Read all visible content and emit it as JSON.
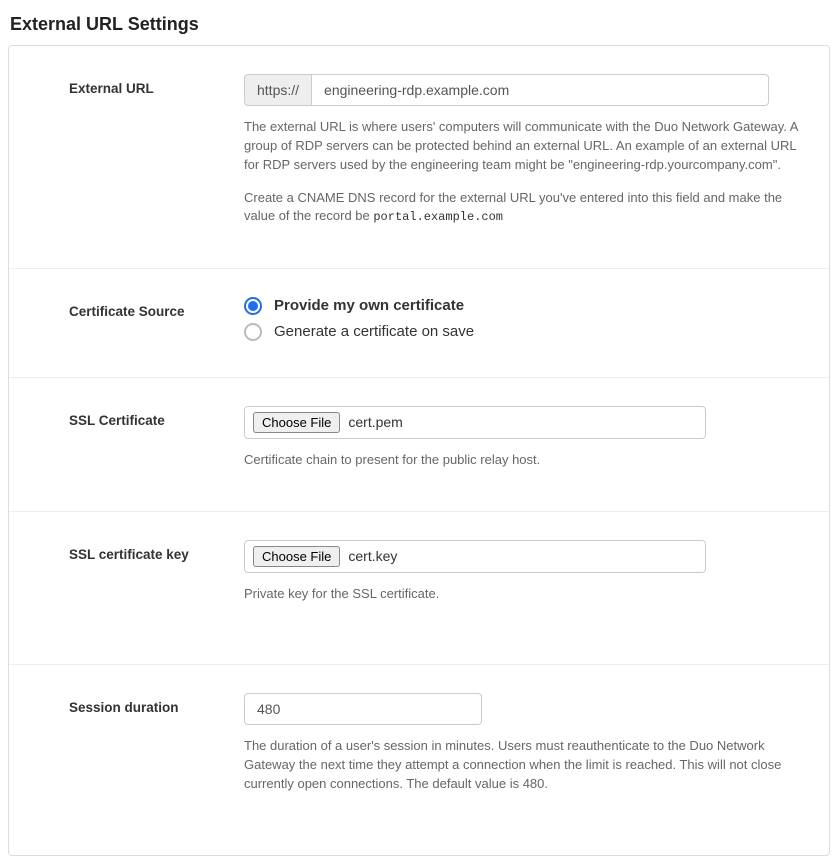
{
  "heading": "External URL Settings",
  "external_url": {
    "label": "External URL",
    "scheme": "https://",
    "value": "engineering-rdp.example.com",
    "help1": "The external URL is where users' computers will communicate with the Duo Network Gateway. A group of RDP servers can be protected behind an external URL. An example of an external URL for RDP servers used by the engineering team might be \"engineering-rdp.yourcompany.com\".",
    "help2_pre": "Create a CNAME DNS record for the external URL you've entered into this field and make the value of the record be ",
    "help2_code": "portal.example.com"
  },
  "cert_source": {
    "label": "Certificate Source",
    "options": [
      {
        "label": "Provide my own certificate",
        "selected": true
      },
      {
        "label": "Generate a certificate on save",
        "selected": false
      }
    ]
  },
  "ssl_cert": {
    "label": "SSL Certificate",
    "button": "Choose File",
    "file": "cert.pem",
    "help": "Certificate chain to present for the public relay host."
  },
  "ssl_key": {
    "label": "SSL certificate key",
    "button": "Choose File",
    "file": "cert.key",
    "help": "Private key for the SSL certificate."
  },
  "session": {
    "label": "Session duration",
    "value": "480",
    "help": "The duration of a user's session in minutes. Users must reauthenticate to the Duo Network Gateway the next time they attempt a connection when the limit is reached. This will not close currently open connections. The default value is 480."
  }
}
